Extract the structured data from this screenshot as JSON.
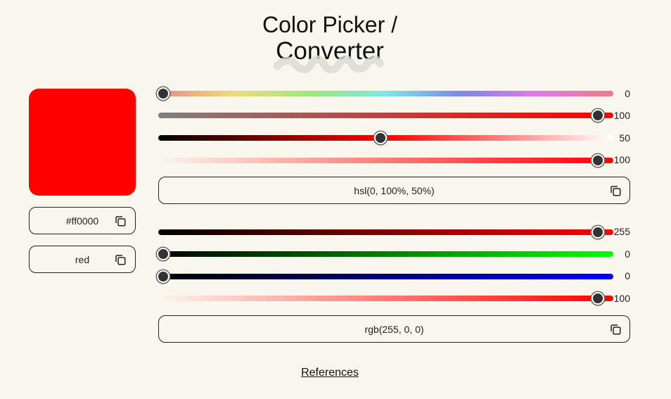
{
  "header": {
    "title_line1": "Color Picker /",
    "title_line2": "Converter"
  },
  "preview": {
    "swatch_color": "#ff0000",
    "hex_value": "#ff0000",
    "name_value": "red"
  },
  "hsl": {
    "sliders": [
      {
        "name": "hue",
        "value": 0,
        "min": 0,
        "max": 360
      },
      {
        "name": "saturation",
        "value": 100,
        "min": 0,
        "max": 100
      },
      {
        "name": "lightness",
        "value": 50,
        "min": 0,
        "max": 100
      },
      {
        "name": "alpha",
        "value": 100,
        "min": 0,
        "max": 100
      }
    ],
    "output": "hsl(0, 100%, 50%)"
  },
  "rgb": {
    "sliders": [
      {
        "name": "red",
        "value": 255,
        "min": 0,
        "max": 255
      },
      {
        "name": "green",
        "value": 0,
        "min": 0,
        "max": 255
      },
      {
        "name": "blue",
        "value": 0,
        "min": 0,
        "max": 255
      },
      {
        "name": "alpha",
        "value": 100,
        "min": 0,
        "max": 100
      }
    ],
    "output": "rgb(255, 0, 0)"
  },
  "footer": {
    "references_label": "References"
  },
  "icons": {
    "copy": "copy-icon"
  }
}
